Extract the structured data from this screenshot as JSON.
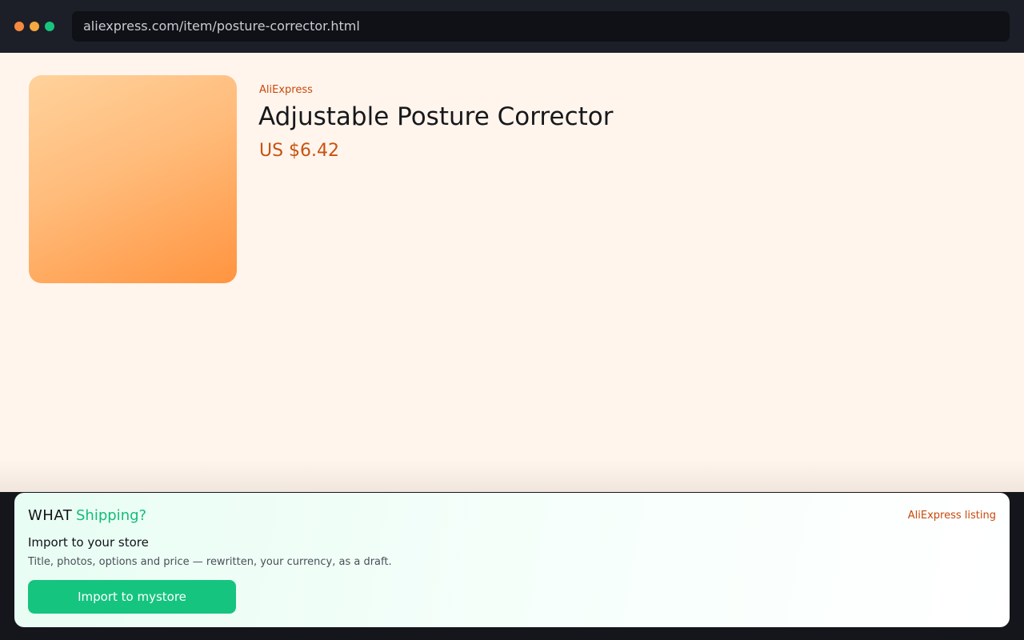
{
  "browser": {
    "url": "aliexpress.com/item/posture-corrector.html"
  },
  "product": {
    "store": "AliExpress",
    "title": "Adjustable Posture Corrector",
    "price": "US $6.42"
  },
  "panel": {
    "brand_primary": "WHAT",
    "brand_secondary": "Shipping?",
    "listing_link": "AliExpress listing",
    "heading": "Import to your store",
    "description": "Title, photos, options and price — rewritten, your currency, as a draft.",
    "import_button": "Import to mystore"
  },
  "colors": {
    "accent_green": "#15c47f",
    "accent_orange": "#c9480c",
    "page_background": "#fff5ec"
  }
}
